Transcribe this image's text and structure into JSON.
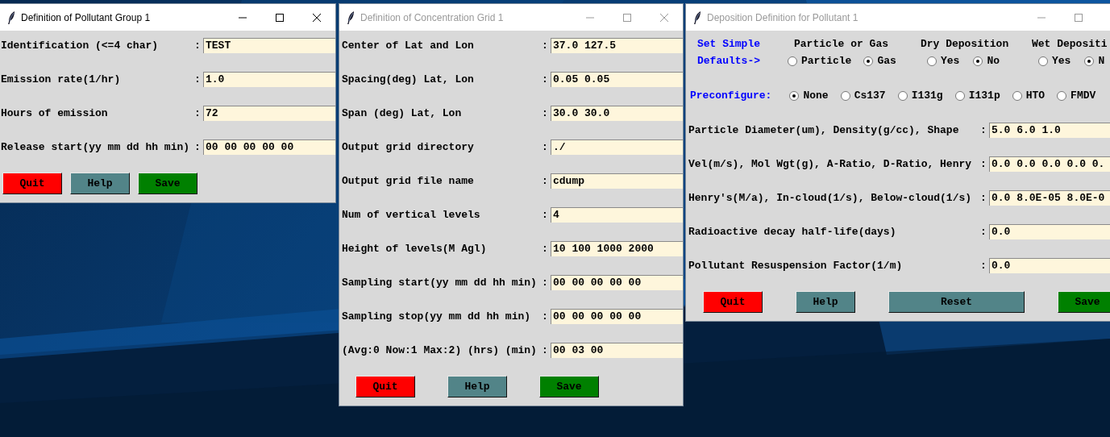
{
  "windows": [
    {
      "title": "Definition of Pollutant Group 1",
      "active": true,
      "title_buttons": [
        {
          "kind": "minimize"
        },
        {
          "kind": "maximize"
        },
        {
          "kind": "close"
        }
      ],
      "fields": [
        {
          "label": "Identification (<=4 char)",
          "colon": ":",
          "value": "TEST"
        },
        {
          "label": "Emission rate(1/hr)",
          "colon": ":",
          "value": "1.0"
        },
        {
          "label": "Hours of emission",
          "colon": ":",
          "value": "72"
        },
        {
          "label": "Release start(yy mm dd hh min)",
          "colon": ":",
          "value": "00 00 00 00 00"
        }
      ],
      "buttons": [
        {
          "label": "Quit",
          "kind": "quit"
        },
        {
          "label": "Help",
          "kind": "help"
        },
        {
          "label": "Save",
          "kind": "save"
        }
      ]
    },
    {
      "title": "Definition of Concentration Grid 1",
      "active": false,
      "title_buttons": [
        {
          "kind": "minimize"
        },
        {
          "kind": "maximize"
        },
        {
          "kind": "close"
        }
      ],
      "fields": [
        {
          "label": "Center of Lat and Lon",
          "colon": ":",
          "value": "37.0 127.5"
        },
        {
          "label": "Spacing(deg) Lat, Lon",
          "colon": ":",
          "value": "0.05 0.05"
        },
        {
          "label": "Span (deg) Lat, Lon",
          "colon": ":",
          "value": "30.0 30.0"
        },
        {
          "label": "Output grid directory",
          "colon": ":",
          "value": "./"
        },
        {
          "label": "Output grid file name",
          "colon": ":",
          "value": "cdump"
        },
        {
          "label": "Num of vertical levels",
          "colon": ":",
          "value": "4"
        },
        {
          "label": "Height of levels(M Agl)",
          "colon": ":",
          "value": "10 100 1000 2000"
        },
        {
          "label": "Sampling start(yy mm dd hh min)",
          "colon": ":",
          "value": "00 00 00 00 00"
        },
        {
          "label": "Sampling stop(yy mm dd hh min)",
          "colon": ":",
          "value": "00 00 00 00 00"
        },
        {
          "label": "(Avg:0 Now:1 Max:2) (hrs) (min)",
          "colon": ":",
          "value": "00 03 00"
        }
      ],
      "buttons": [
        {
          "label": "Quit",
          "kind": "quit"
        },
        {
          "label": "Help",
          "kind": "help"
        },
        {
          "label": "Save",
          "kind": "save"
        }
      ]
    },
    {
      "title": "Deposition Definition for Pollutant 1",
      "active": false,
      "title_buttons": [
        {
          "kind": "minimize"
        },
        {
          "kind": "maximize"
        }
      ],
      "defaults": {
        "label_lines": [
          "Set Simple",
          "Defaults->"
        ],
        "groups": [
          {
            "title": "Particle or Gas",
            "options": [
              {
                "label": "Particle",
                "selected": false
              },
              {
                "label": "Gas",
                "selected": true
              }
            ]
          },
          {
            "title": "Dry Deposition",
            "options": [
              {
                "label": "Yes",
                "selected": false
              },
              {
                "label": "No",
                "selected": true
              }
            ]
          },
          {
            "title": "Wet Depositi",
            "options": [
              {
                "label": "Yes",
                "selected": false
              },
              {
                "label": "N",
                "selected": true
              }
            ]
          }
        ]
      },
      "preconfigure": {
        "label": "Preconfigure:",
        "options": [
          {
            "label": "None",
            "selected": true
          },
          {
            "label": "Cs137",
            "selected": false
          },
          {
            "label": "I131g",
            "selected": false
          },
          {
            "label": "I131p",
            "selected": false
          },
          {
            "label": "HTO",
            "selected": false
          },
          {
            "label": "FMDV",
            "selected": false
          }
        ]
      },
      "fields": [
        {
          "label": "Particle Diameter(um), Density(g/cc), Shape",
          "colon": ":",
          "value": "5.0 6.0 1.0"
        },
        {
          "label": "Vel(m/s), Mol Wgt(g), A-Ratio, D-Ratio, Henry",
          "colon": ":",
          "value": "0.0 0.0 0.0 0.0 0."
        },
        {
          "label": "Henry's(M/a), In-cloud(1/s), Below-cloud(1/s)",
          "colon": ":",
          "value": "0.0 8.0E-05 8.0E-0"
        },
        {
          "label": "Radioactive decay half-life(days)",
          "colon": ":",
          "value": "0.0"
        },
        {
          "label": "Pollutant Resuspension Factor(1/m)",
          "colon": ":",
          "value": "0.0"
        }
      ],
      "buttons": [
        {
          "label": "Quit",
          "kind": "quit"
        },
        {
          "label": "Help",
          "kind": "help"
        },
        {
          "label": "Reset",
          "kind": "reset"
        },
        {
          "label": "Save",
          "kind": "save"
        }
      ]
    }
  ]
}
